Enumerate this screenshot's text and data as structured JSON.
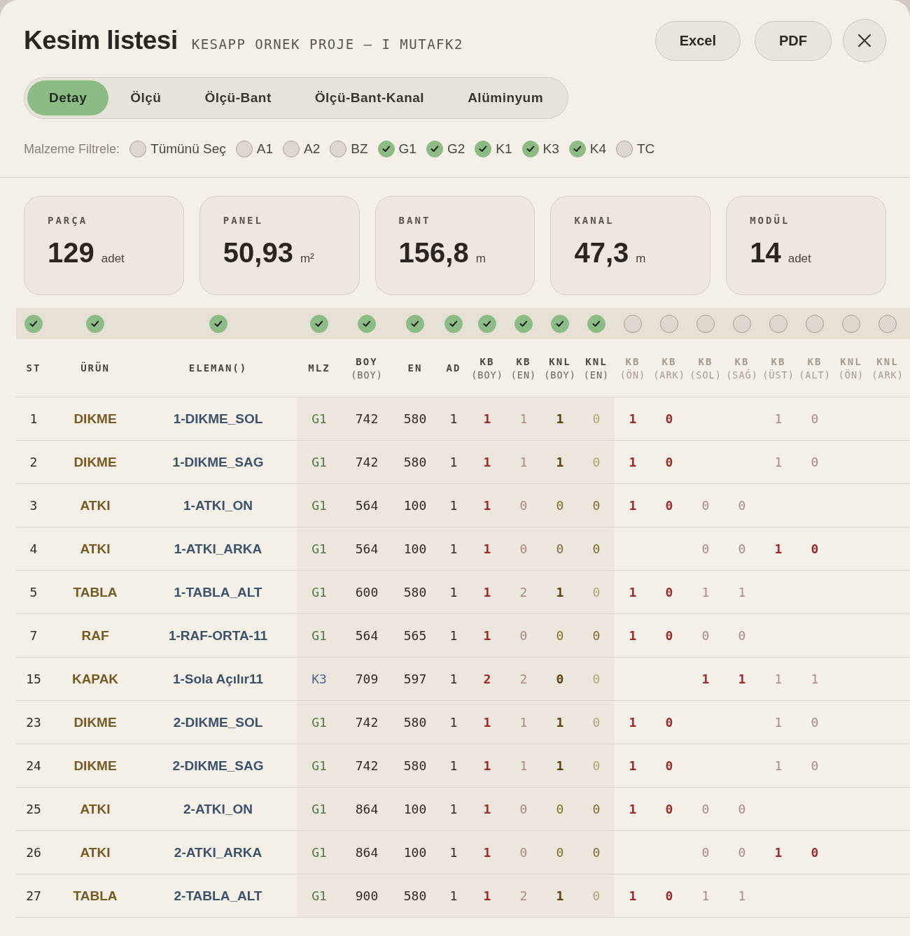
{
  "title": "Kesim listesi",
  "subtitle": "KESAPP ORNEK PROJE — I MUTAFK2",
  "actions": [
    {
      "kind": "text",
      "label": "Excel"
    },
    {
      "kind": "text",
      "label": "PDF"
    },
    {
      "kind": "close"
    }
  ],
  "tabs": [
    {
      "label": "Detay",
      "selected": true
    },
    {
      "label": "Ölçü",
      "selected": false
    },
    {
      "label": "Ölçü-Bant",
      "selected": false
    },
    {
      "label": "Ölçü-Bant-Kanal",
      "selected": false
    },
    {
      "label": "Alüminyum",
      "selected": false
    }
  ],
  "filter": {
    "label": "Malzeme Filtrele:",
    "options": [
      {
        "label": "Tümünü Seç",
        "checked": false
      },
      {
        "label": "A1",
        "checked": false
      },
      {
        "label": "A2",
        "checked": false
      },
      {
        "label": "BZ",
        "checked": false
      },
      {
        "label": "G1",
        "checked": true
      },
      {
        "label": "G2",
        "checked": true
      },
      {
        "label": "K1",
        "checked": true
      },
      {
        "label": "K3",
        "checked": true
      },
      {
        "label": "K4",
        "checked": true
      },
      {
        "label": "TC",
        "checked": false
      }
    ]
  },
  "stats": [
    {
      "label": "PARÇA",
      "value": "129",
      "unit": "adet"
    },
    {
      "label": "PANEL",
      "value": "50,93",
      "unit": "m²"
    },
    {
      "label": "BANT",
      "value": "156,8",
      "unit": "m"
    },
    {
      "label": "KANAL",
      "value": "47,3",
      "unit": "m"
    },
    {
      "label": "MODÜL",
      "value": "14",
      "unit": "adet"
    }
  ],
  "columns": [
    {
      "label": "ST",
      "checked": true
    },
    {
      "label": "ÜRÜN",
      "checked": true
    },
    {
      "label": "ELEMAN()",
      "checked": true
    },
    {
      "label": "MLZ",
      "checked": true
    },
    {
      "label": "BOY",
      "sub": "(BOY)",
      "checked": true
    },
    {
      "label": "EN",
      "checked": true
    },
    {
      "label": "AD",
      "checked": true
    },
    {
      "label": "KB",
      "sub": "(BOY)",
      "checked": true
    },
    {
      "label": "KB",
      "sub": "(EN)",
      "checked": true
    },
    {
      "label": "KNL",
      "sub": "(BOY)",
      "checked": true
    },
    {
      "label": "KNL",
      "sub": "(EN)",
      "checked": true
    },
    {
      "label": "KB",
      "sub": "(ÖN)",
      "checked": false
    },
    {
      "label": "KB",
      "sub": "(ARK)",
      "checked": false
    },
    {
      "label": "KB",
      "sub": "(SOL)",
      "checked": false
    },
    {
      "label": "KB",
      "sub": "(SAĞ)",
      "checked": false
    },
    {
      "label": "KB",
      "sub": "(ÜST)",
      "checked": false
    },
    {
      "label": "KB",
      "sub": "(ALT)",
      "checked": false
    },
    {
      "label": "KNL",
      "sub": "(ÖN)",
      "checked": false
    },
    {
      "label": "KNL",
      "sub": "(ARK)",
      "checked": false
    }
  ],
  "rows": [
    {
      "st": "1",
      "urun": "DIKME",
      "eleman": "1-DIKME_SOL",
      "mlz": {
        "text": "G1",
        "color": "#4f7a4a"
      },
      "boy": "742",
      "en": "580",
      "ad": "1",
      "edges": {
        "kb_boy": {
          "v": "1",
          "bold": true
        },
        "kb_en": {
          "v": "1",
          "faint": true
        },
        "knl_boy": {
          "v": "1",
          "bold": true
        },
        "knl_en": {
          "v": "0",
          "faint": true
        },
        "kb_on": {
          "v": "1",
          "bold": true
        },
        "kb_ark": {
          "v": "0",
          "bold": true
        },
        "kb_ust": {
          "v": "1",
          "faint": true
        },
        "kb_alt": {
          "v": "0",
          "faint": true
        }
      }
    },
    {
      "st": "2",
      "urun": "DIKME",
      "eleman": "1-DIKME_SAG",
      "mlz": {
        "text": "G1",
        "color": "#4f7a4a"
      },
      "boy": "742",
      "en": "580",
      "ad": "1",
      "edges": {
        "kb_boy": {
          "v": "1",
          "bold": true
        },
        "kb_en": {
          "v": "1",
          "faint": true
        },
        "knl_boy": {
          "v": "1",
          "bold": true
        },
        "knl_en": {
          "v": "0",
          "faint": true
        },
        "kb_on": {
          "v": "1",
          "bold": true
        },
        "kb_ark": {
          "v": "0",
          "bold": true
        },
        "kb_ust": {
          "v": "1",
          "faint": true
        },
        "kb_alt": {
          "v": "0",
          "faint": true
        }
      }
    },
    {
      "st": "3",
      "urun": "ATKI",
      "eleman": "1-ATKI_ON",
      "mlz": {
        "text": "G1",
        "color": "#4f7a4a"
      },
      "boy": "564",
      "en": "100",
      "ad": "1",
      "edges": {
        "kb_boy": {
          "v": "1",
          "bold": true
        },
        "kb_en": {
          "v": "0",
          "faint": true
        },
        "knl_boy": {
          "v": "0"
        },
        "knl_en": {
          "v": "0"
        },
        "kb_on": {
          "v": "1",
          "bold": true
        },
        "kb_ark": {
          "v": "0",
          "bold": true
        },
        "kb_sol": {
          "v": "0",
          "faint": true
        },
        "kb_sag": {
          "v": "0",
          "faint": true
        }
      }
    },
    {
      "st": "4",
      "urun": "ATKI",
      "eleman": "1-ATKI_ARKA",
      "mlz": {
        "text": "G1",
        "color": "#4f7a4a"
      },
      "boy": "564",
      "en": "100",
      "ad": "1",
      "edges": {
        "kb_boy": {
          "v": "1",
          "bold": true
        },
        "kb_en": {
          "v": "0",
          "faint": true
        },
        "knl_boy": {
          "v": "0"
        },
        "knl_en": {
          "v": "0"
        },
        "kb_sol": {
          "v": "0",
          "faint": true
        },
        "kb_sag": {
          "v": "0",
          "faint": true
        },
        "kb_ust": {
          "v": "1",
          "bold": true
        },
        "kb_alt": {
          "v": "0",
          "bold": true
        }
      }
    },
    {
      "st": "5",
      "urun": "TABLA",
      "eleman": "1-TABLA_ALT",
      "mlz": {
        "text": "G1",
        "color": "#4f7a4a"
      },
      "boy": "600",
      "en": "580",
      "ad": "1",
      "edges": {
        "kb_boy": {
          "v": "1",
          "bold": true
        },
        "kb_en": {
          "v": "2",
          "faint": true
        },
        "knl_boy": {
          "v": "1",
          "bold": true
        },
        "knl_en": {
          "v": "0",
          "faint": true
        },
        "kb_on": {
          "v": "1",
          "bold": true
        },
        "kb_ark": {
          "v": "0",
          "bold": true
        },
        "kb_sol": {
          "v": "1",
          "faint": true
        },
        "kb_sag": {
          "v": "1",
          "faint": true
        }
      }
    },
    {
      "st": "7",
      "urun": "RAF",
      "eleman": "1-RAF-ORTA-11",
      "mlz": {
        "text": "G1",
        "color": "#4f7a4a"
      },
      "boy": "564",
      "en": "565",
      "ad": "1",
      "edges": {
        "kb_boy": {
          "v": "1",
          "bold": true
        },
        "kb_en": {
          "v": "0",
          "faint": true
        },
        "knl_boy": {
          "v": "0"
        },
        "knl_en": {
          "v": "0"
        },
        "kb_on": {
          "v": "1",
          "bold": true
        },
        "kb_ark": {
          "v": "0",
          "bold": true
        },
        "kb_sol": {
          "v": "0",
          "faint": true
        },
        "kb_sag": {
          "v": "0",
          "faint": true
        }
      }
    },
    {
      "st": "15",
      "urun": "KAPAK",
      "eleman": "1-Sola Açılır11",
      "mlz": {
        "text": "K3",
        "color": "#4a6a8c"
      },
      "boy": "709",
      "en": "597",
      "ad": "1",
      "edges": {
        "kb_boy": {
          "v": "2",
          "bold": true
        },
        "kb_en": {
          "v": "2",
          "faint": true
        },
        "knl_boy": {
          "v": "0",
          "bold": true
        },
        "knl_en": {
          "v": "0",
          "faint": true
        },
        "kb_sol": {
          "v": "1",
          "bold": true
        },
        "kb_sag": {
          "v": "1",
          "bold": true
        },
        "kb_ust": {
          "v": "1",
          "faint": true
        },
        "kb_alt": {
          "v": "1",
          "faint": true
        }
      }
    },
    {
      "st": "23",
      "urun": "DIKME",
      "eleman": "2-DIKME_SOL",
      "mlz": {
        "text": "G1",
        "color": "#4f7a4a"
      },
      "boy": "742",
      "en": "580",
      "ad": "1",
      "edges": {
        "kb_boy": {
          "v": "1",
          "bold": true
        },
        "kb_en": {
          "v": "1",
          "faint": true
        },
        "knl_boy": {
          "v": "1",
          "bold": true
        },
        "knl_en": {
          "v": "0",
          "faint": true
        },
        "kb_on": {
          "v": "1",
          "bold": true
        },
        "kb_ark": {
          "v": "0",
          "bold": true
        },
        "kb_ust": {
          "v": "1",
          "faint": true
        },
        "kb_alt": {
          "v": "0",
          "faint": true
        }
      }
    },
    {
      "st": "24",
      "urun": "DIKME",
      "eleman": "2-DIKME_SAG",
      "mlz": {
        "text": "G1",
        "color": "#4f7a4a"
      },
      "boy": "742",
      "en": "580",
      "ad": "1",
      "edges": {
        "kb_boy": {
          "v": "1",
          "bold": true
        },
        "kb_en": {
          "v": "1",
          "faint": true
        },
        "knl_boy": {
          "v": "1",
          "bold": true
        },
        "knl_en": {
          "v": "0",
          "faint": true
        },
        "kb_on": {
          "v": "1",
          "bold": true
        },
        "kb_ark": {
          "v": "0",
          "bold": true
        },
        "kb_ust": {
          "v": "1",
          "faint": true
        },
        "kb_alt": {
          "v": "0",
          "faint": true
        }
      }
    },
    {
      "st": "25",
      "urun": "ATKI",
      "eleman": "2-ATKI_ON",
      "mlz": {
        "text": "G1",
        "color": "#4f7a4a"
      },
      "boy": "864",
      "en": "100",
      "ad": "1",
      "edges": {
        "kb_boy": {
          "v": "1",
          "bold": true
        },
        "kb_en": {
          "v": "0",
          "faint": true
        },
        "knl_boy": {
          "v": "0"
        },
        "knl_en": {
          "v": "0"
        },
        "kb_on": {
          "v": "1",
          "bold": true
        },
        "kb_ark": {
          "v": "0",
          "bold": true
        },
        "kb_sol": {
          "v": "0",
          "faint": true
        },
        "kb_sag": {
          "v": "0",
          "faint": true
        }
      }
    },
    {
      "st": "26",
      "urun": "ATKI",
      "eleman": "2-ATKI_ARKA",
      "mlz": {
        "text": "G1",
        "color": "#4f7a4a"
      },
      "boy": "864",
      "en": "100",
      "ad": "1",
      "edges": {
        "kb_boy": {
          "v": "1",
          "bold": true
        },
        "kb_en": {
          "v": "0",
          "faint": true
        },
        "knl_boy": {
          "v": "0"
        },
        "knl_en": {
          "v": "0"
        },
        "kb_sol": {
          "v": "0",
          "faint": true
        },
        "kb_sag": {
          "v": "0",
          "faint": true
        },
        "kb_ust": {
          "v": "1",
          "bold": true
        },
        "kb_alt": {
          "v": "0",
          "bold": true
        }
      }
    },
    {
      "st": "27",
      "urun": "TABLA",
      "eleman": "2-TABLA_ALT",
      "mlz": {
        "text": "G1",
        "color": "#4f7a4a"
      },
      "boy": "900",
      "en": "580",
      "ad": "1",
      "edges": {
        "kb_boy": {
          "v": "1",
          "bold": true
        },
        "kb_en": {
          "v": "2",
          "faint": true
        },
        "knl_boy": {
          "v": "1",
          "bold": true
        },
        "knl_en": {
          "v": "0",
          "faint": true
        },
        "kb_on": {
          "v": "1",
          "bold": true
        },
        "kb_ark": {
          "v": "0",
          "bold": true
        },
        "kb_sol": {
          "v": "1",
          "faint": true
        },
        "kb_sag": {
          "v": "1",
          "faint": true
        }
      }
    }
  ]
}
